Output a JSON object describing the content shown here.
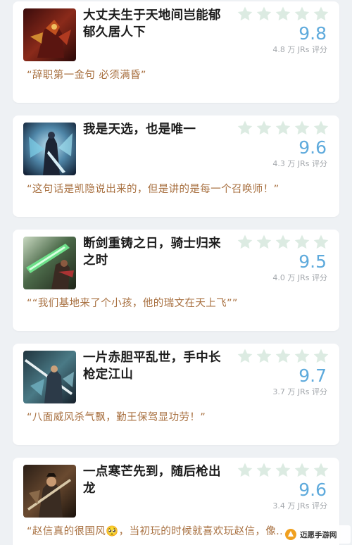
{
  "colors": {
    "score": "#5eaadc",
    "star": "#dcebe2",
    "quote": "#a87040",
    "title": "#1c1c1c",
    "votes": "#a4a8ad",
    "background": "#eef1f4"
  },
  "items": [
    {
      "title": "大丈夫生于天地间岂能郁郁久居人下",
      "score": "9.8",
      "votes": "4.8 万 JRs 评分",
      "quote": "“辞职第一金句 必须满昏”",
      "image": "hero-portrait-red-armor"
    },
    {
      "title": "我是天选，也是唯一",
      "score": "9.6",
      "votes": "4.3 万 JRs 评分",
      "quote": "“这句话是凯隐说出来的，但是讲的是每一个召唤师！”",
      "image": "hero-portrait-blue-shadow"
    },
    {
      "title": "断剑重铸之日，骑士归来之时",
      "score": "9.5",
      "votes": "4.0 万 JRs 评分",
      "quote": "““我们基地来了个小孩，他的瑞文在天上飞””",
      "image": "hero-portrait-green-sword"
    },
    {
      "title": "一片赤胆平乱世，手中长枪定江山",
      "score": "9.7",
      "votes": "3.7 万 JRs 评分",
      "quote": "“八面威风杀气飘，勤王保驾显功劳！”",
      "image": "hero-portrait-teal-spear"
    },
    {
      "title": "一点寒芒先到，随后枪出龙",
      "score": "9.6",
      "votes": "3.4 万 JRs 评分",
      "quote": "“赵信真的很国风🥺，当初玩的时候就喜欢玩赵信，像...",
      "image": "hero-portrait-brown-warrior"
    }
  ],
  "watermark": {
    "text": "迈愿手游网",
    "icon": "site-logo-icon"
  }
}
